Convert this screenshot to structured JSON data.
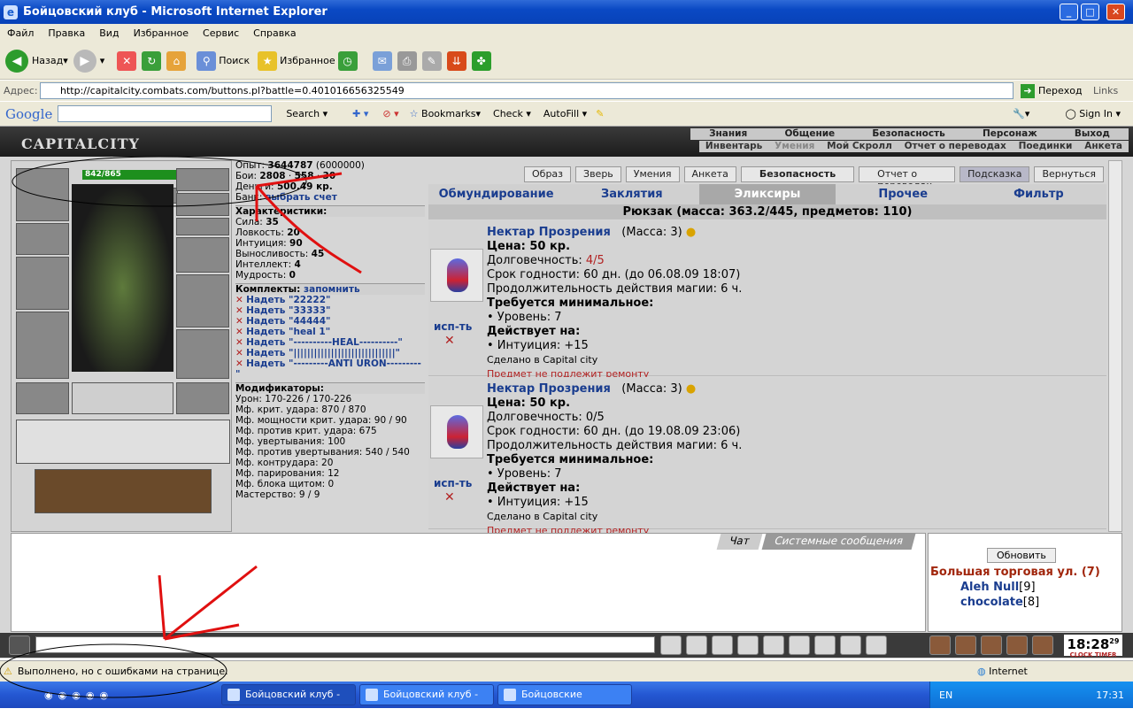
{
  "window": {
    "title": "Бойцовский клуб - Microsoft Internet Explorer"
  },
  "menu": [
    "Файл",
    "Правка",
    "Вид",
    "Избранное",
    "Сервис",
    "Справка"
  ],
  "toolbar": {
    "back": "Назад",
    "search": "Поиск",
    "favorites": "Избранное"
  },
  "address": {
    "label": "Адрес:",
    "url": "http://capitalcity.combats.com/buttons.pl?battle=0.401016656325549",
    "go": "Переход",
    "links": "Links"
  },
  "google": {
    "logo": "Google",
    "search": "Search",
    "bookmarks": "Bookmarks",
    "check": "Check",
    "autofill": "AutoFill",
    "signin": "Sign In"
  },
  "site": {
    "logo": "CAPITALCITY",
    "topnav": [
      "Знания",
      "Общение",
      "Безопасность",
      "Персонаж",
      "Выход"
    ],
    "subnav": [
      "Инвентарь",
      "Умения",
      "Мой Скролл",
      "Отчет о переводах",
      "Поединки",
      "Анкета"
    ]
  },
  "char": {
    "hp": "842/865"
  },
  "stats": {
    "exp_label": "Опыт:",
    "exp": "3644787",
    "exp_next": "(6000000)",
    "fights_label": "Бои:",
    "fights": "2808",
    "wins": "558",
    "losses": "30",
    "money_label": "Деньги:",
    "money": "500.49 кр.",
    "bank_label": "Банк:",
    "bank": "выбрать счет",
    "section_chars": "Характеристики:",
    "attrs": [
      {
        "name": "Сила:",
        "value": "35"
      },
      {
        "name": "Ловкость:",
        "value": "20"
      },
      {
        "name": "Интуиция:",
        "value": "90"
      },
      {
        "name": "Выносливость:",
        "value": "45"
      },
      {
        "name": "Интеллект:",
        "value": "4"
      },
      {
        "name": "Мудрость:",
        "value": "0"
      }
    ],
    "section_sets": "Комплекты:",
    "remember": "запомнить",
    "sets": [
      "Надеть \"22222\"",
      "Надеть \"33333\"",
      "Надеть \"44444\"",
      "Надеть \"heal 1\"",
      "Надеть \"----------HEAL----------\"",
      "Надеть \"||||||||||||||||||||||||||||||\"",
      "Надеть \"---------ANTI URON---------\""
    ],
    "section_mods": "Модификаторы:",
    "mods": [
      "Урон: 170-226 / 170-226",
      "Мф. крит. удара: 870 / 870",
      "Мф. мощности крит. удара: 90 / 90",
      "Мф. против крит. удара: 675",
      "Мф. увертывания: 100",
      "Мф. против увертывания: 540 / 540",
      "Мф. контрудара: 20",
      "Мф. парирования: 12",
      "Мф. блока щитом: 0",
      "Мастерство: 9 / 9"
    ]
  },
  "buttons": [
    "Образ",
    "Зверь",
    "Умения",
    "Анкета",
    "Безопасность",
    "Отчет о переводах",
    "Подсказка",
    "Вернуться"
  ],
  "itemtabs": [
    "Обмундирование",
    "Заклятия",
    "Эликсиры",
    "Прочее",
    "Фильтр"
  ],
  "rucksack": "Рюкзак (масса: 363.2/445, предметов: 110)",
  "items": [
    {
      "name": "Нектар Прозрения",
      "mass": "(Масса: 3)",
      "price": "Цена: 50 кр.",
      "durability_label": "Долговечность:",
      "durability": "4/5",
      "expiry": "Срок годности: 60 дн. (до 06.08.09 18:07)",
      "duration": "Продолжительность действия магии: 6 ч.",
      "req_label": "Требуется минимальное:",
      "req": "• Уровень: 7",
      "acts_label": "Действует на:",
      "acts": "• Интуиция: +15",
      "made": "Сделано в Capital city",
      "norepair": "Предмет не подлежит ремонту",
      "use": "исп-ть"
    },
    {
      "name": "Нектар Прозрения",
      "mass": "(Масса: 3)",
      "price": "Цена: 50 кр.",
      "durability_label": "Долговечность:",
      "durability": "0/5",
      "expiry": "Срок годности: 60 дн. (до 19.08.09 23:06)",
      "duration": "Продолжительность действия магии: 6 ч.",
      "req_label": "Требуется минимальное:",
      "req": "• Уровень: 7",
      "acts_label": "Действует на:",
      "acts": "• Интуиция: +15",
      "made": "Сделано в Capital city",
      "norepair": "Предмет не подлежит ремонту",
      "use": "исп-ть"
    }
  ],
  "chat": {
    "tab_chat": "Чат",
    "tab_system": "Системные сообщения",
    "refresh": "Обновить",
    "room": "Большая торговая ул. (7)",
    "users": [
      {
        "name": "Aleh Null",
        "level": "[9]"
      },
      {
        "name": "chocolate",
        "level": "[8]"
      }
    ]
  },
  "clock": {
    "time": "18:28",
    "sec": "29",
    "l1": "CLOCK",
    "l2": "TIMER"
  },
  "status": {
    "text": "Выполнено, но с ошибками на странице.",
    "zone": "Internet"
  },
  "taskbar": {
    "tasks": [
      "Бойцовский клуб - Mi...",
      "Бойцовский клуб - Mi...",
      "Бойцовские дневник..."
    ],
    "lang": "EN",
    "time": "17:31"
  }
}
